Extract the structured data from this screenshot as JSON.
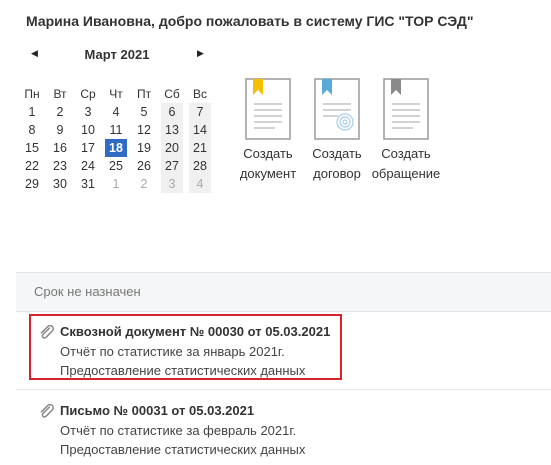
{
  "header": {
    "welcome": "Марина Ивановна, добро пожаловать в систему ГИС \"ТОР СЭД\""
  },
  "calendar": {
    "prev_icon": "◀",
    "next_icon": "▶",
    "month_label": "Март 2021",
    "weekdays": [
      "Пн",
      "Вт",
      "Ср",
      "Чт",
      "Пт",
      "Сб",
      "Вс"
    ],
    "weeks": [
      [
        "1",
        "2",
        "3",
        "4",
        "5",
        "6",
        "7"
      ],
      [
        "8",
        "9",
        "10",
        "11",
        "12",
        "13",
        "14"
      ],
      [
        "15",
        "16",
        "17",
        "18",
        "19",
        "20",
        "21"
      ],
      [
        "22",
        "23",
        "24",
        "25",
        "26",
        "27",
        "28"
      ],
      [
        "29",
        "30",
        "31",
        "1",
        "2",
        "3",
        "4"
      ]
    ],
    "today": "18",
    "colors": {
      "today": "#2f6bc2",
      "weekend_bg": "#f0f0f0"
    }
  },
  "create": {
    "document": {
      "line1": "Создать",
      "line2": "документ",
      "bookmark_color": "#f2c200",
      "icon": "document-icon"
    },
    "contract": {
      "line1": "Создать",
      "line2": "договор",
      "bookmark_color": "#5aa9d8",
      "icon": "contract-icon"
    },
    "appeal": {
      "line1": "Создать",
      "line2": "обращение",
      "bookmark_color": "#8a8a8a",
      "icon": "appeal-icon"
    }
  },
  "section": {
    "label": "Срок не назначен"
  },
  "items": [
    {
      "title": "Сквозной документ № 00030 от 05.03.2021",
      "line1": "Отчёт по статистике за январь 2021г.",
      "line2": "Предоставление статистических данных"
    },
    {
      "title": "Письмо № 00031 от 05.03.2021",
      "line1": "Отчёт по статистике за февраль 2021г.",
      "line2": "Предоставление статистических данных"
    }
  ],
  "highlight_color": "#d9232c"
}
